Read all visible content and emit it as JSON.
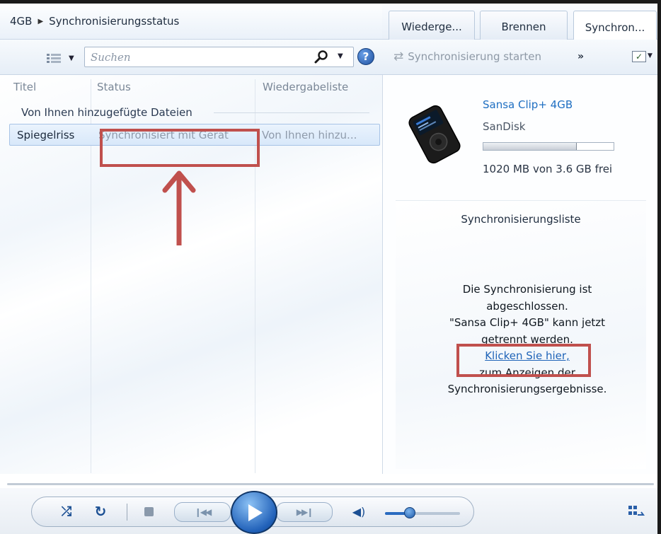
{
  "header": {
    "breadcrumb_device": "4GB",
    "breadcrumb_page": "Synchronisierungsstatus"
  },
  "tabs": [
    {
      "label": "Wiederge...",
      "active": false
    },
    {
      "label": "Brennen",
      "active": false
    },
    {
      "label": "Synchron...",
      "active": true
    }
  ],
  "toolbar": {
    "search_placeholder": "Suchen",
    "view_icon": "view-options-icon",
    "search_icon": "magnifier-icon",
    "help_icon": "help-icon",
    "help_label": "?",
    "sync_start_label": "Synchronisierung starten",
    "more_label": "»",
    "options_label": "✓"
  },
  "list": {
    "columns": [
      "Titel",
      "Status",
      "Wiedergabeliste"
    ],
    "group_label": "Von Ihnen hinzugefügte Dateien",
    "rows": [
      {
        "title": "Spiegelriss",
        "status": "Synchronisiert mit Gerät",
        "playlist": "Von Ihnen hinzu..."
      }
    ]
  },
  "device": {
    "name": "Sansa Clip+ 4GB",
    "manufacturer": "SanDisk",
    "storage_used_fraction": 0.72,
    "storage_text": "1020 MB von 3.6 GB frei"
  },
  "sync_list": {
    "title": "Synchronisierungsliste",
    "message_lines": [
      "Die Synchronisierung ist",
      "abgeschlossen.",
      "\"Sansa Clip+ 4GB\" kann jetzt",
      "getrennt werden."
    ],
    "link_text": "Klicken Sie hier,",
    "after_link_lines": [
      "zum Anzeigen der",
      "Synchronisierungsergebnisse."
    ]
  },
  "player": {
    "volume_level": 0.3
  },
  "colors": {
    "annotation": "#c0504d",
    "link": "#1f64b8",
    "accent": "#2161b9"
  }
}
